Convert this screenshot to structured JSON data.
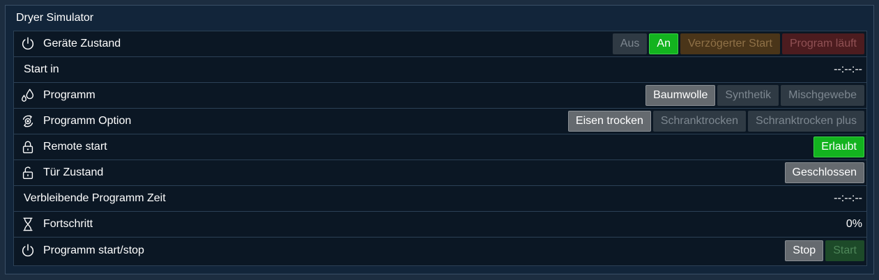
{
  "panel": {
    "title": "Dryer Simulator"
  },
  "rows": {
    "geraete_zustand": {
      "label": "Geräte Zustand",
      "icon": "power-icon",
      "buttons": {
        "aus": "Aus",
        "an": "An",
        "verzoegert": "Verzögerter Start",
        "laeuft": "Program läuft"
      },
      "selected": "An"
    },
    "start_in": {
      "label": "Start in",
      "value": "--:--:--"
    },
    "programm": {
      "label": "Programm",
      "icon": "droplets-icon",
      "buttons": {
        "baumwolle": "Baumwolle",
        "synthetik": "Synthetik",
        "mischgewebe": "Mischgewebe"
      },
      "selected": "Baumwolle"
    },
    "programm_option": {
      "label": "Programm Option",
      "icon": "cycle-icon",
      "buttons": {
        "eisen": "Eisen trocken",
        "schrank": "Schranktrocken",
        "schrank_plus": "Schranktrocken plus"
      },
      "selected": "Eisen trocken"
    },
    "remote_start": {
      "label": "Remote start",
      "icon": "lock-closed-icon",
      "button": "Erlaubt"
    },
    "tuer_zustand": {
      "label": "Tür Zustand",
      "icon": "lock-open-icon",
      "button": "Geschlossen"
    },
    "verbleibende_zeit": {
      "label": "Verbleibende Programm Zeit",
      "value": "--:--:--"
    },
    "fortschritt": {
      "label": "Fortschritt",
      "icon": "hourglass-icon",
      "value": "0%"
    },
    "start_stop": {
      "label": "Programm start/stop",
      "icon": "power-icon",
      "buttons": {
        "stop": "Stop",
        "start": "Start"
      }
    }
  },
  "colors": {
    "background": "#1c2d40",
    "panel": "#12253a",
    "active_green": "#13b31f",
    "active_gray": "#656a6f"
  }
}
